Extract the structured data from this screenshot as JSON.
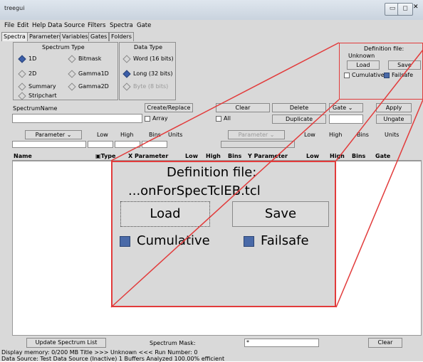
{
  "window": {
    "title": "treegui"
  },
  "menu": [
    "File",
    "Edit",
    "Help",
    "Data Source",
    "Filters",
    "Spectra",
    "Gate"
  ],
  "tabs": [
    {
      "label": "Spectra",
      "active": true
    },
    {
      "label": "Parameters",
      "active": false
    },
    {
      "label": "Variables",
      "active": false
    },
    {
      "label": "Gates",
      "active": false
    },
    {
      "label": "Folders",
      "active": false
    }
  ],
  "spectrum_type": {
    "title": "Spectrum Type",
    "options": [
      {
        "label": "1D",
        "selected": true
      },
      {
        "label": "Bitmask",
        "selected": false
      },
      {
        "label": "2D",
        "selected": false
      },
      {
        "label": "Gamma1D",
        "selected": false
      },
      {
        "label": "Summary",
        "selected": false
      },
      {
        "label": "Gamma2D",
        "selected": false
      },
      {
        "label": "Stripchart",
        "selected": false
      }
    ]
  },
  "data_type": {
    "title": "Data Type",
    "options": [
      {
        "label": "Word (16 bits)",
        "selected": false,
        "enabled": true
      },
      {
        "label": "Long (32 bits)",
        "selected": true,
        "enabled": true
      },
      {
        "label": "Byte (8 bits)",
        "selected": false,
        "enabled": false
      }
    ]
  },
  "definition": {
    "title": "Definition file:",
    "file_small": "Unknown",
    "file_zoomed": "...onForSpecTclEB.tcl",
    "load": "Load",
    "save": "Save",
    "cumulative": "Cumulative",
    "failsafe": "Failsafe"
  },
  "spectrum_row": {
    "name_label": "SpectrumName",
    "create": "Create/Replace",
    "array": "Array",
    "clear": "Clear",
    "all": "All",
    "delete": "Delete",
    "duplicate": "Duplicate",
    "gate_label": "Gate",
    "apply": "Apply",
    "ungate": "Ungate"
  },
  "param_row_left": {
    "parameter": "Parameter",
    "low": "Low",
    "high": "High",
    "bins": "Bins",
    "units": "Units"
  },
  "param_row_right": {
    "parameter": "Parameter",
    "low": "Low",
    "high": "High",
    "bins": "Bins",
    "units": "Units"
  },
  "table_headers": [
    "Name",
    "Type",
    "X Parameter",
    "Low",
    "High",
    "Bins",
    "Y Parameter",
    "Low",
    "High",
    "Bins",
    "Gate"
  ],
  "bottom": {
    "update": "Update Spectrum List",
    "mask_label": "Spectrum Mask:",
    "mask_value": "*",
    "clear": "Clear"
  },
  "status": {
    "line1": "Display memory: 0/200 MB   Title >>> Unknown <<< Run Number: 0",
    "line2": "Data Source: Test Data Source (Inactive) 1 Buffers Analyzed 100.00% efficient"
  },
  "colors": {
    "highlight": "#e23b3b",
    "selected_radio": "#3b5ea8"
  }
}
